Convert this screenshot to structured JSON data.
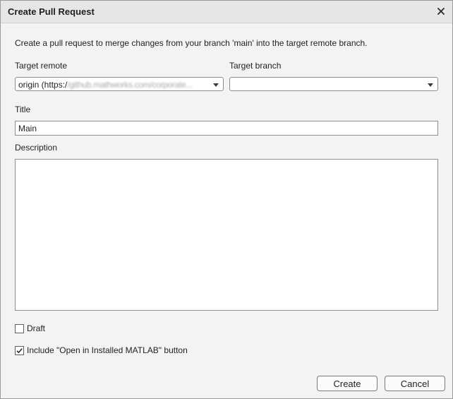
{
  "dialog": {
    "title": "Create Pull Request",
    "intro": "Create a pull request to merge changes from your branch 'main' into the target remote branch."
  },
  "target_remote": {
    "label": "Target remote",
    "value_prefix": "origin (https:/",
    "value_blurred": "/github.mathworks.com/corporate...",
    "arrow_icon": "dropdown-arrow-icon"
  },
  "target_branch": {
    "label": "Target branch",
    "value": ""
  },
  "title_field": {
    "label": "Title",
    "value": "Main"
  },
  "description_field": {
    "label": "Description",
    "value": ""
  },
  "draft": {
    "label": "Draft",
    "checked": false
  },
  "include_button": {
    "label": "Include \"Open in Installed MATLAB\" button",
    "checked": true
  },
  "buttons": {
    "create": "Create",
    "cancel": "Cancel"
  },
  "colors": {
    "dialog_bg": "#f3f3f3",
    "titlebar_bg": "#e6e6e6",
    "border": "#8f8f8f"
  }
}
